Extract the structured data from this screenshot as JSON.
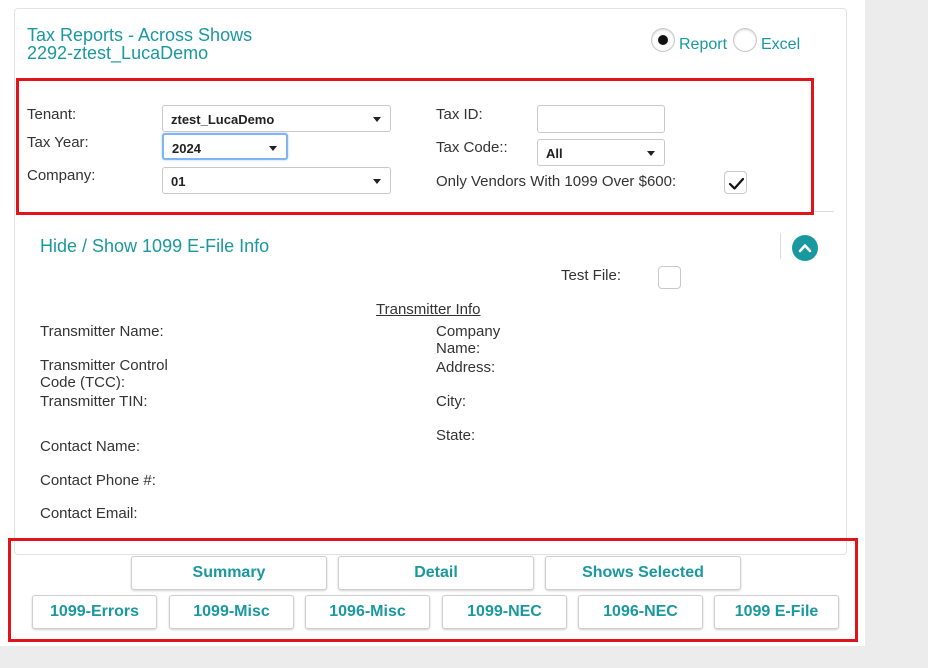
{
  "header": {
    "title_line1": "Tax Reports - Across Shows",
    "title_line2": "2292-ztest_LucaDemo"
  },
  "output_format": {
    "options": [
      {
        "label": "Report",
        "selected": true
      },
      {
        "label": "Excel",
        "selected": false
      }
    ]
  },
  "filters": {
    "tenant_label": "Tenant:",
    "tenant_value": "ztest_LucaDemo",
    "tax_year_label": "Tax Year:",
    "tax_year_value": "2024",
    "company_label": "Company:",
    "company_value": "01",
    "tax_id_label": "Tax ID:",
    "tax_id_value": "",
    "tax_code_label": "Tax Code::",
    "tax_code_value": "All",
    "vendors_1099_label": "Only Vendors With 1099 Over $600:",
    "vendors_1099_checked": true
  },
  "efile": {
    "toggle_label": "Hide / Show 1099 E-File Info",
    "test_file_label": "Test File:",
    "test_file_checked": false,
    "section_title": "Transmitter Info",
    "left_fields": [
      "Transmitter Name:",
      "Transmitter Control Code (TCC):",
      "Transmitter TIN:",
      "Contact Name:",
      "Contact Phone #:",
      "Contact Email:"
    ],
    "right_fields": [
      "Company Name:",
      "Address:",
      "City:",
      "State:"
    ]
  },
  "buttons": {
    "row1": [
      "Summary",
      "Detail",
      "Shows Selected"
    ],
    "row2": [
      "1099-Errors",
      "1099-Misc",
      "1096-Misc",
      "1099-NEC",
      "1096-NEC",
      "1099 E-File"
    ]
  },
  "colors": {
    "accent": "#1a98a0",
    "highlight_border": "#e0141b",
    "focus_border": "#7fb5f5"
  }
}
